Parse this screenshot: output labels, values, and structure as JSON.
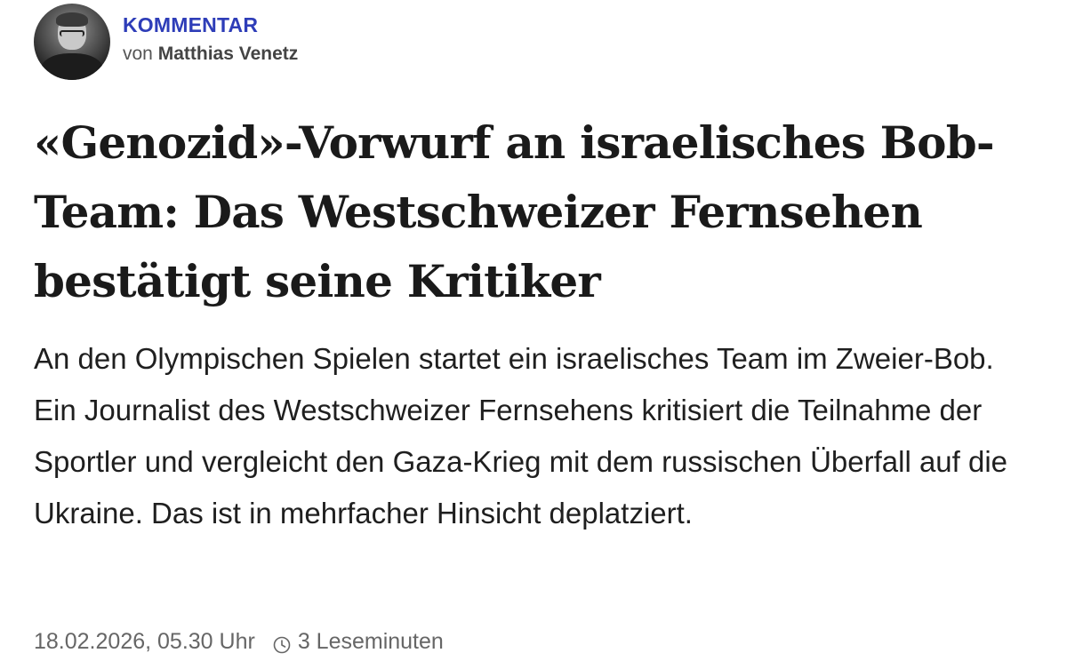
{
  "article": {
    "kicker": "KOMMENTAR",
    "byline_prefix": "von",
    "author": "Matthias Venetz",
    "headline": "«Genozid»-Vorwurf an israelisches Bob-Team: Das Westschweizer Fernsehen bestätigt seine Kritiker",
    "lead": "An den Olympischen Spielen startet ein israelisches Team im Zweier-Bob. Ein Journalist des Westschweizer Fernsehens kritisiert die Teilnahme der Sportler und vergleicht den Gaza-Krieg mit dem russischen Überfall auf die Ukraine. Das ist in mehrfacher Hinsicht deplatziert.",
    "date": "18.02.2026, 05.30 Uhr",
    "reading_time": "3 Leseminuten",
    "reading_time_icon": "clock-icon"
  },
  "colors": {
    "kicker": "#2e3db8",
    "headline": "#1a1a1a",
    "meta": "#666666"
  }
}
